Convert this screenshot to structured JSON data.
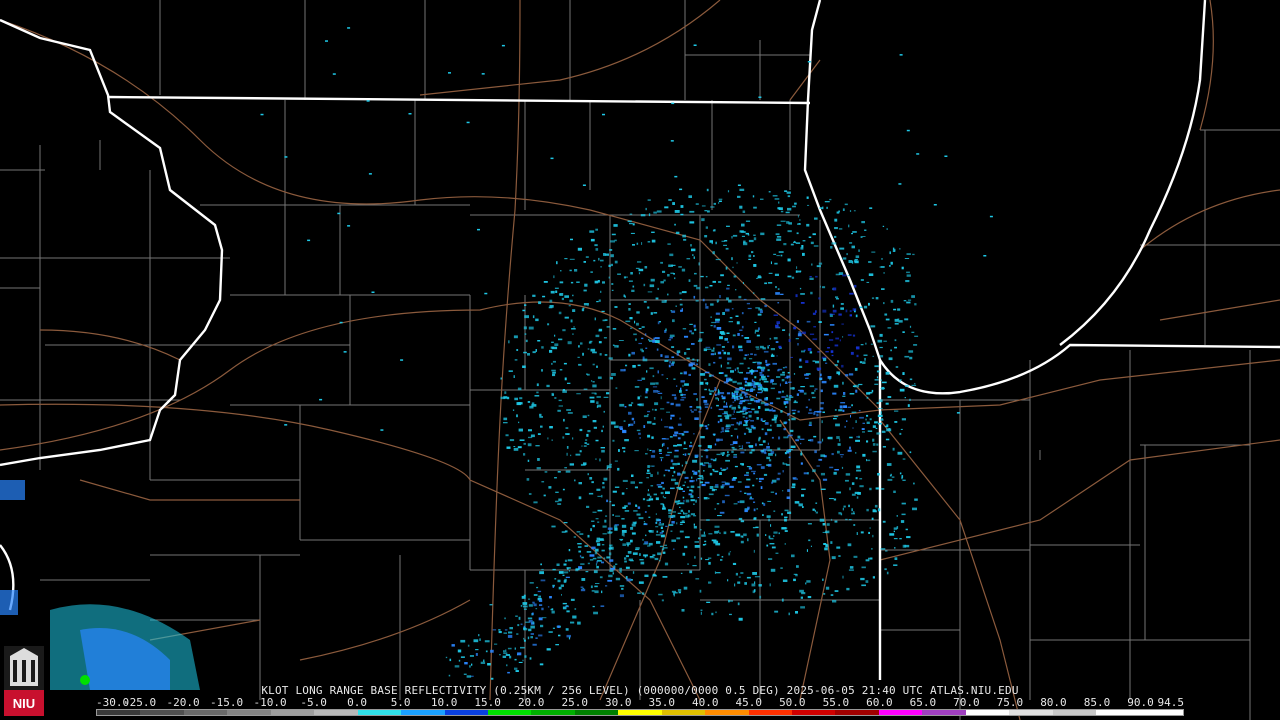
{
  "map": {
    "product_caption": "KLOT LONG RANGE BASE REFLECTIVITY (0.25KM / 256 LEVEL) (000000/0000 0.5 DEG) 2025-06-05 21:40 UTC  ATLAS.NIU.EDU",
    "radar_site": "KLOT",
    "logo_text": "NIU",
    "colors": {
      "background": "#000000",
      "state_borders": "#ffffff",
      "county_lines": "#8a8a8a",
      "roads": "#8b5a3c",
      "echo_light": "#1ec8e6",
      "echo_medium": "#2a86ff",
      "echo_heavy": "#1533d8"
    }
  },
  "colorbar": {
    "labels": [
      "-30.0",
      "-25.0",
      "-20.0",
      "-15.0",
      "-10.0",
      "-5.0",
      "0.0",
      "5.0",
      "10.0",
      "15.0",
      "20.0",
      "25.0",
      "30.0",
      "35.0",
      "40.0",
      "45.0",
      "50.0",
      "55.0",
      "60.0",
      "65.0",
      "70.0",
      "75.0",
      "80.0",
      "85.0",
      "90.0",
      "94.5"
    ],
    "colors": [
      "#3a3a3a",
      "#505050",
      "#6a6a6a",
      "#848484",
      "#9e9e9e",
      "#b8b8b8",
      "#30e0e8",
      "#1aa0ff",
      "#0a40e0",
      "#00e000",
      "#00b000",
      "#008000",
      "#ffff00",
      "#e0c000",
      "#ff8c00",
      "#ff3000",
      "#d00000",
      "#a00000",
      "#ff00ff",
      "#a040c0",
      "#ffffff",
      "#e0e0e0",
      "#c8c8c8",
      "#ffffff",
      "#ffffff"
    ]
  }
}
